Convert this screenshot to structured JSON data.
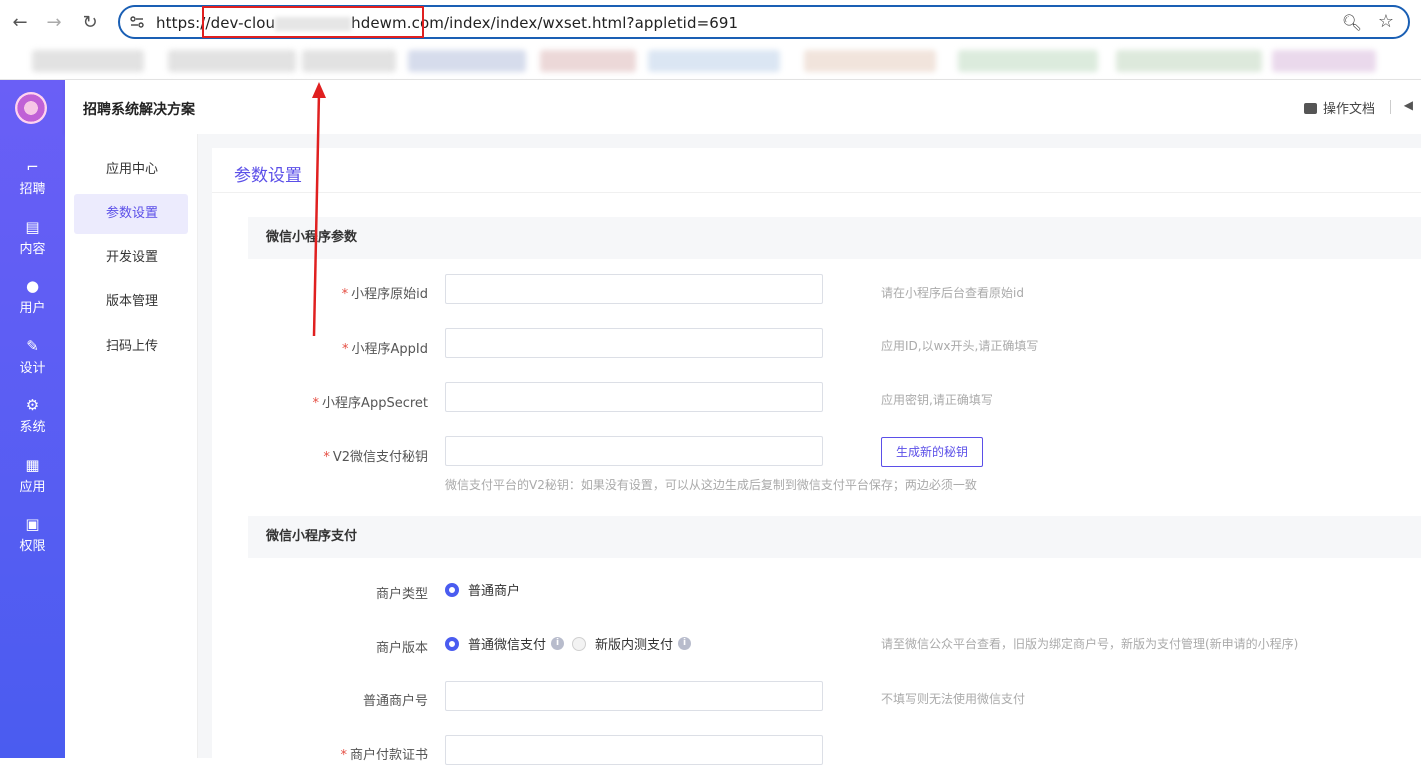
{
  "browser": {
    "url_prefix": "https://",
    "url_host_start": "dev-clou",
    "url_host_end": "hdewm.com",
    "url_path": "/index/index/wxset.html?appletid=691"
  },
  "colors": {
    "accent": "#5b4fe8",
    "rail": "#4a5cf0",
    "required": "#e54d42",
    "annotation": "#e02020"
  },
  "rail": {
    "items": [
      {
        "label": "招聘",
        "icon": "pin-icon"
      },
      {
        "label": "内容",
        "icon": "document-icon"
      },
      {
        "label": "用户",
        "icon": "user-icon"
      },
      {
        "label": "设计",
        "icon": "brush-icon"
      },
      {
        "label": "系统",
        "icon": "gear-icon"
      },
      {
        "label": "应用",
        "icon": "grid-icon"
      },
      {
        "label": "权限",
        "icon": "lock-icon"
      }
    ]
  },
  "topbar": {
    "brand": "招聘系统解决方案",
    "doc_label": "操作文档"
  },
  "subnav": {
    "items": [
      {
        "label": "应用中心"
      },
      {
        "label": "参数设置"
      },
      {
        "label": "开发设置"
      },
      {
        "label": "版本管理"
      },
      {
        "label": "扫码上传"
      }
    ]
  },
  "panel": {
    "title": "参数设置",
    "section1": "微信小程序参数",
    "section2": "微信小程序支付",
    "fields": [
      {
        "label": "小程序原始id",
        "hint": "请在小程序后台查看原始id"
      },
      {
        "label": "小程序AppId",
        "hint": "应用ID,以wx开头,请正确填写"
      },
      {
        "label": "小程序AppSecret",
        "hint": "应用密钥,请正确填写"
      },
      {
        "label": "V2微信支付秘钥",
        "button": "生成新的秘钥",
        "sub_hint": "微信支付平台的V2秘钥：如果没有设置，可以从这边生成后复制到微信支付平台保存；两边必须一致"
      }
    ],
    "merchant_type": {
      "label": "商户类型",
      "option": "普通商户"
    },
    "merchant_version": {
      "label": "商户版本",
      "option1": "普通微信支付",
      "option2": "新版内测支付",
      "hint": "请至微信公众平台查看，旧版为绑定商户号，新版为支付管理(新申请的小程序)"
    },
    "merchant_no": {
      "label": "普通商户号",
      "hint": "不填写则无法使用微信支付"
    },
    "cert": {
      "label": "商户付款证书"
    }
  }
}
